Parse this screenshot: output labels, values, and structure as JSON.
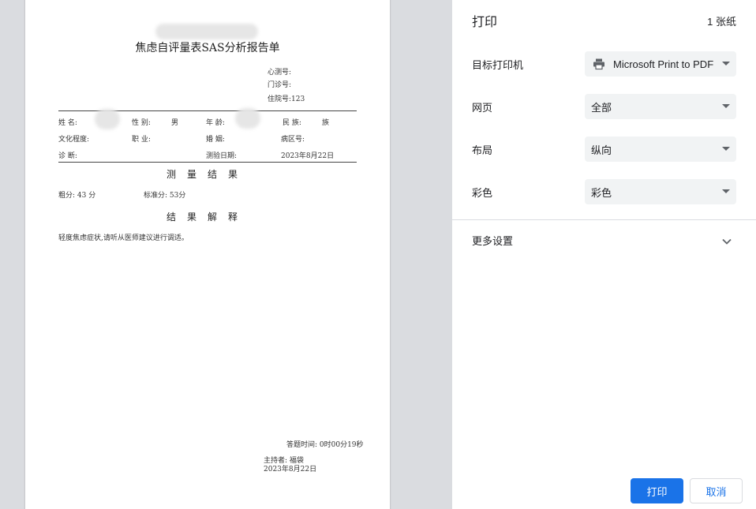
{
  "document": {
    "title": "焦虑自评量表SAS分析报告单",
    "meta": [
      "心测号:",
      "门诊号:",
      "住院号:123"
    ],
    "info_rows": [
      [
        "姓  名:",
        "性  别:",
        "男",
        "年  龄:",
        "民  族:",
        "族"
      ],
      [
        "文化程度:",
        "职  业:",
        "婚  姻:",
        "病区号:"
      ],
      [
        "诊  断:",
        "测验日期:",
        "2023年8月22日"
      ]
    ],
    "section_results": "测量结果",
    "raw_score": "粗分: 43 分",
    "std_score": "标准分: 53分",
    "section_interpretation": "结果解释",
    "interpretation_text": "轻度焦虑症状,请听从医师建议进行调适。",
    "answer_time": "答题时间: 0时00分19秒",
    "host": "主持者: 福袋",
    "report_date": "2023年8月22日"
  },
  "settings": {
    "title": "打印",
    "sheet_count": "1 张纸",
    "destination_label": "目标打印机",
    "destination_value": "Microsoft Print to PDF",
    "pages_label": "网页",
    "pages_value": "全部",
    "layout_label": "布局",
    "layout_value": "纵向",
    "color_label": "彩色",
    "color_value": "彩色",
    "more_settings_label": "更多设置",
    "print_button": "打印",
    "cancel_button": "取消"
  },
  "colors": {
    "accent": "#1a73e8",
    "select_bg": "#f1f3f4",
    "preview_bg": "#dadce0"
  },
  "icons": [
    "printer-icon",
    "chevron-down-icon",
    "dropdown-caret-icon"
  ]
}
